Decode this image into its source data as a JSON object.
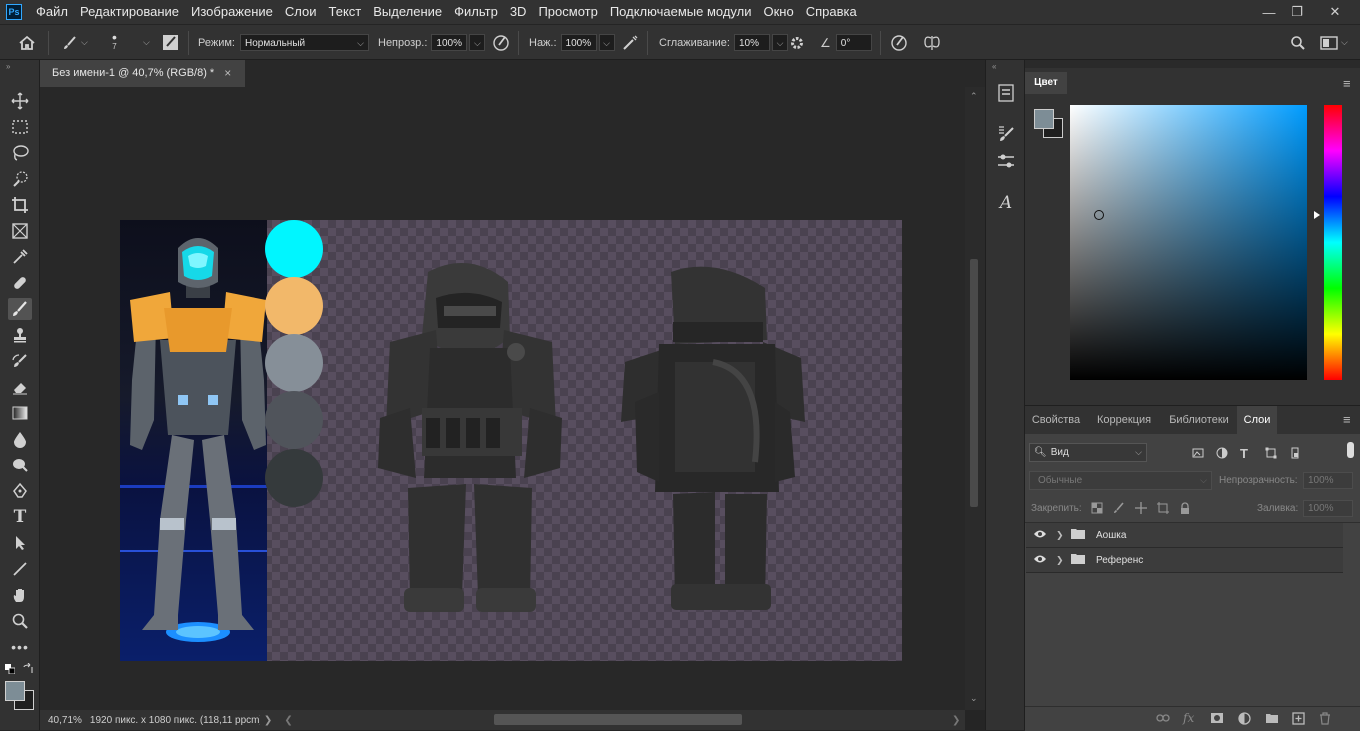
{
  "app": {
    "logo": "Ps"
  },
  "menu": [
    "Файл",
    "Редактирование",
    "Изображение",
    "Слои",
    "Текст",
    "Выделение",
    "Фильтр",
    "3D",
    "Просмотр",
    "Подключаемые модули",
    "Окно",
    "Справка"
  ],
  "window_controls": {
    "minimize": "—",
    "restore": "❐",
    "close": "✕"
  },
  "options": {
    "brush_size": "7",
    "mode_label": "Режим:",
    "mode_value": "Нормальный",
    "opacity_label": "Непрозр.:",
    "opacity_value": "100%",
    "flow_label": "Наж.:",
    "flow_value": "100%",
    "smoothing_label": "Сглаживание:",
    "smoothing_value": "10%",
    "angle_value": "0°"
  },
  "document": {
    "tab_title": "Без имени-1 @ 40,7% (RGB/8) *",
    "tab_close": "×",
    "zoom": "40,71%",
    "info": "1920 пикс. x 1080 пикс. (118,11 ppcm)"
  },
  "swatches": [
    "#00f6ff",
    "#f2b86a",
    "#868f98",
    "#50545b",
    "#353a3c"
  ],
  "color_panel": {
    "title": "Цвет",
    "foreground": "#7d8d96",
    "background": "#1f1f1f"
  },
  "layers_panel": {
    "tabs": [
      "Свойства",
      "Коррекция",
      "Библиотеки",
      "Слои"
    ],
    "filter_kind": "Вид",
    "blend_mode": "Обычные",
    "opacity_label": "Непрозрачность:",
    "opacity_value": "100%",
    "lock_label": "Закрепить:",
    "fill_label": "Заливка:",
    "fill_value": "100%",
    "layers": [
      {
        "name": "Аошка",
        "visible": true,
        "type": "group"
      },
      {
        "name": "Референс",
        "visible": true,
        "type": "group"
      }
    ]
  }
}
